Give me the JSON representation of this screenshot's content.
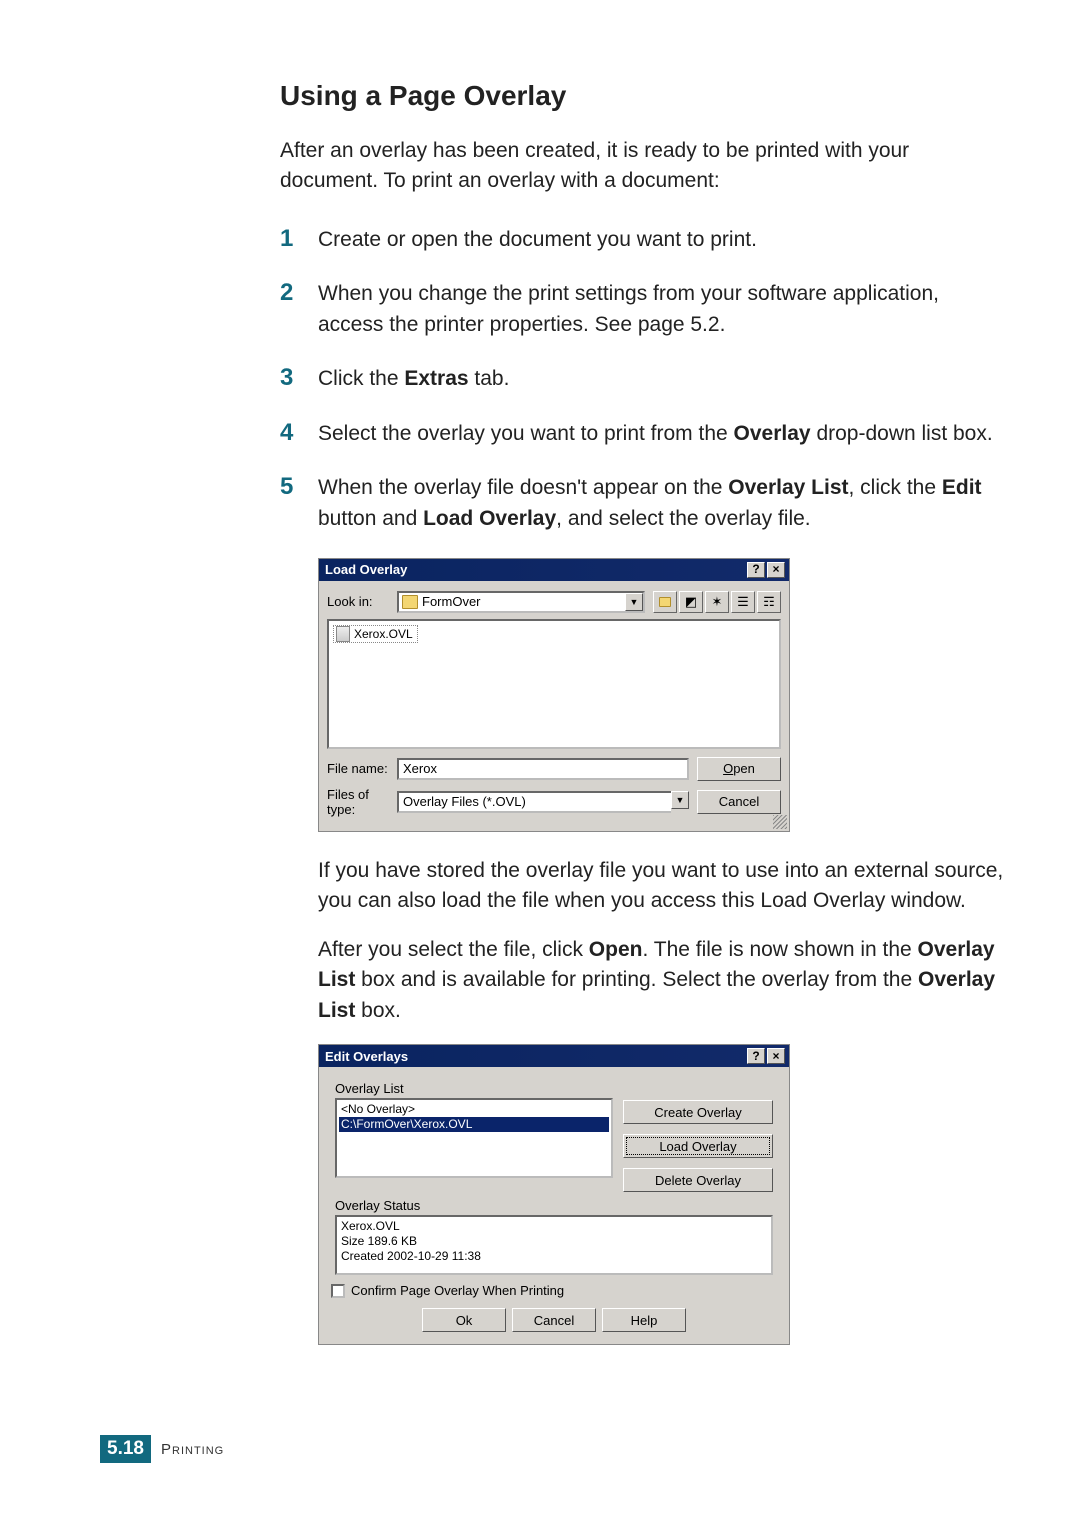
{
  "heading": "Using a Page Overlay",
  "intro": "After an overlay has been created, it is ready to be printed with your document. To print an overlay with a document:",
  "steps": {
    "s1": {
      "num": "1",
      "text": "Create or open the document you want to print."
    },
    "s2": {
      "num": "2",
      "text": "When you change the print settings from your software application, access the printer properties. See page 5.2."
    },
    "s3": {
      "num": "3",
      "pre": "Click the ",
      "bold1": "Extras",
      "post": " tab."
    },
    "s4": {
      "num": "4",
      "pre": "Select the overlay you want to print from the ",
      "bold1": "Overlay",
      "post": " drop-down list box."
    },
    "s5": {
      "num": "5",
      "pre": "When the overlay file doesn't appear on the ",
      "bold1": "Overlay List",
      "mid1": ", click the ",
      "bold2": "Edit",
      "mid2": " button and ",
      "bold3": "Load Overlay",
      "post": ", and select the overlay file."
    }
  },
  "para1": "If you have stored the overlay file you want to use into an external source, you can also load the file when you access this Load Overlay window.",
  "para2": {
    "pre": "After you select the file, click ",
    "b1": "Open",
    "mid1": ". The file is now shown in the ",
    "b2": "Overlay List",
    "mid2": " box and is available for printing. Select the overlay from the ",
    "b3": "Overlay List",
    "post": " box."
  },
  "dlg1": {
    "title": "Load Overlay",
    "help": "?",
    "close": "×",
    "lookin_label": "Look in:",
    "lookin_value": "FormOver",
    "file_item": "Xerox.OVL",
    "filename_label": "File name:",
    "filename_value": "Xerox",
    "filetype_label": "Files of type:",
    "filetype_value": "Overlay Files (*.OVL)",
    "open": "Open",
    "cancel": "Cancel"
  },
  "dlg2": {
    "title": "Edit Overlays",
    "help": "?",
    "close": "×",
    "list_label": "Overlay List",
    "list_items": {
      "i0": "<No Overlay>",
      "i1": "C:\\FormOver\\Xerox.OVL"
    },
    "create": "Create Overlay",
    "load": "Load Overlay",
    "delete": "Delete Overlay",
    "status_label": "Overlay Status",
    "status_lines": {
      "l0": "Xerox.OVL",
      "l1": "Size 189.6 KB",
      "l2": "Created 2002-10-29 11:38"
    },
    "confirm": "Confirm Page Overlay When Printing",
    "ok": "Ok",
    "cancel": "Cancel",
    "helpbtn": "Help"
  },
  "footer": {
    "chapter": "5",
    "dot": ".",
    "page": "18",
    "section": "Printing"
  }
}
